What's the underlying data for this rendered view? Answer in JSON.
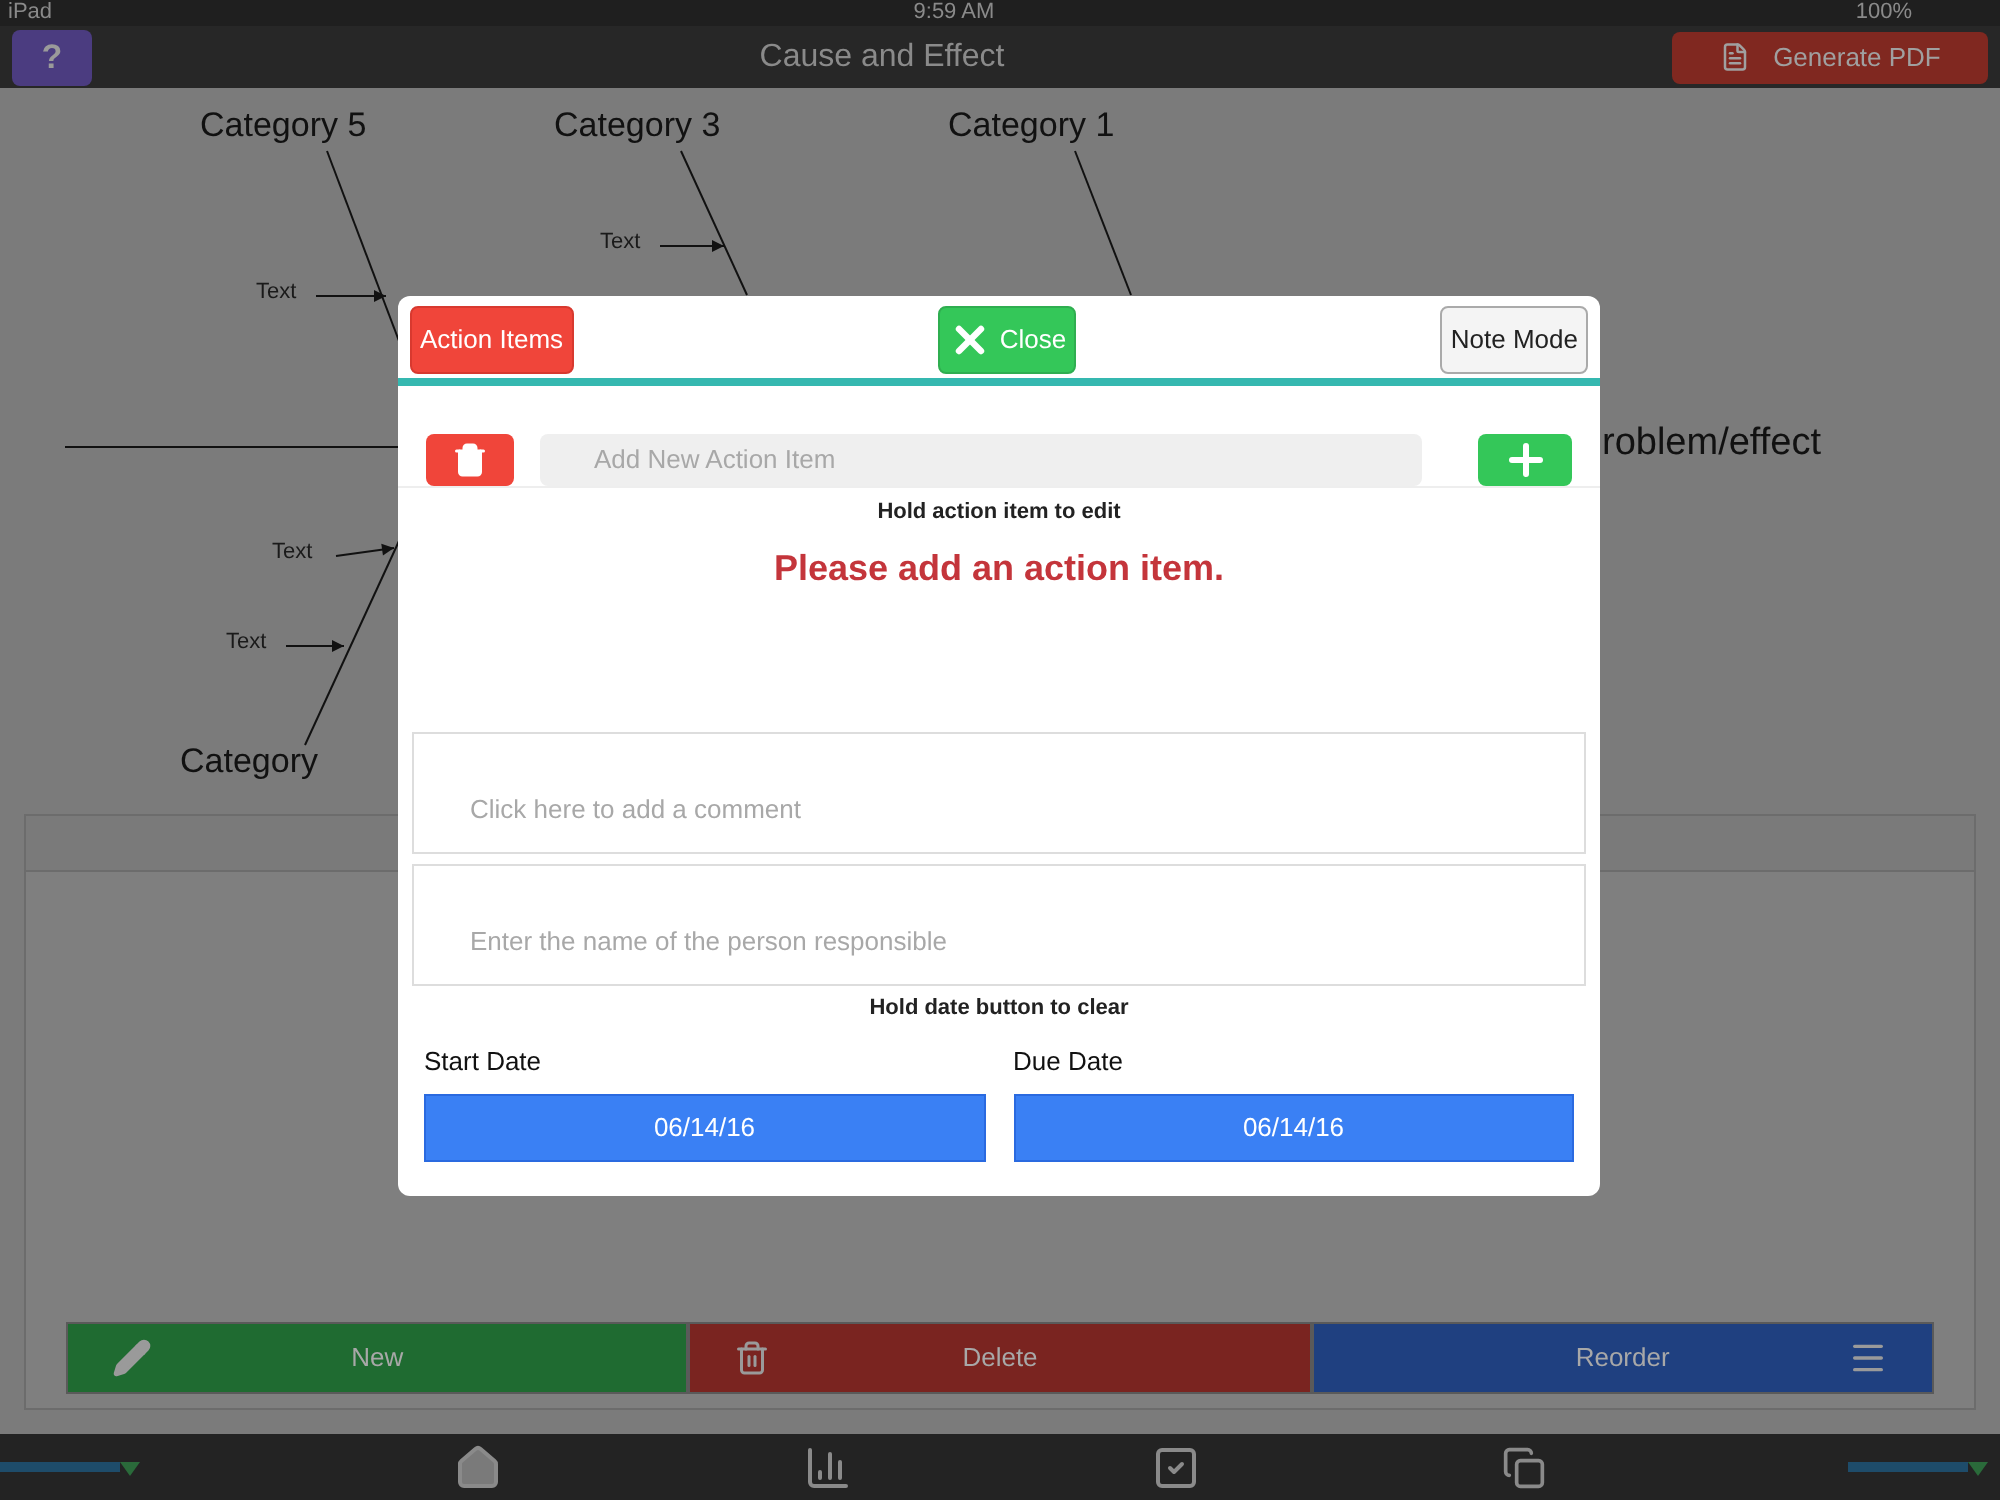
{
  "status_bar": {
    "carrier": "iPad",
    "time": "9:59 AM",
    "battery": "100%"
  },
  "header": {
    "help_button": "?",
    "title": "Cause and Effect",
    "pdf_button": "Generate PDF"
  },
  "diagram": {
    "labels": [
      {
        "kind": "category",
        "text": "Category 5"
      },
      {
        "kind": "category",
        "text": "Category 3"
      },
      {
        "kind": "category",
        "text": "Category 1"
      },
      {
        "kind": "cause",
        "text": "Text"
      },
      {
        "kind": "cause",
        "text": "Text"
      },
      {
        "kind": "cause",
        "text": "Text"
      },
      {
        "kind": "cause",
        "text": "Text"
      },
      {
        "kind": "category",
        "text": "Category"
      },
      {
        "kind": "effect",
        "text": "roblem/effect"
      }
    ]
  },
  "panel": {
    "buttons": [
      {
        "kind": "new",
        "label": "New"
      },
      {
        "kind": "delete",
        "label": "Delete"
      },
      {
        "kind": "reorder",
        "label": "Reorder"
      }
    ]
  },
  "modal": {
    "header_buttons": [
      {
        "kind": "mode",
        "label": "Action Items",
        "selected": true
      },
      {
        "kind": "close",
        "label": "Close"
      },
      {
        "kind": "mode",
        "label": "Note Mode",
        "selected": false
      }
    ],
    "new_item": {
      "placeholder": "Add New Action Item"
    },
    "edit_hint": "Hold action item to edit",
    "empty_message": "Please add an action item.",
    "comment": {
      "placeholder": "Click here to add a comment"
    },
    "responsible": {
      "placeholder": "Enter the name of the person responsible"
    },
    "date_hint": "Hold date button to clear",
    "dates": [
      {
        "label": "Start Date",
        "value": "06/14/16"
      },
      {
        "label": "Due Date",
        "value": "06/14/16"
      }
    ]
  }
}
